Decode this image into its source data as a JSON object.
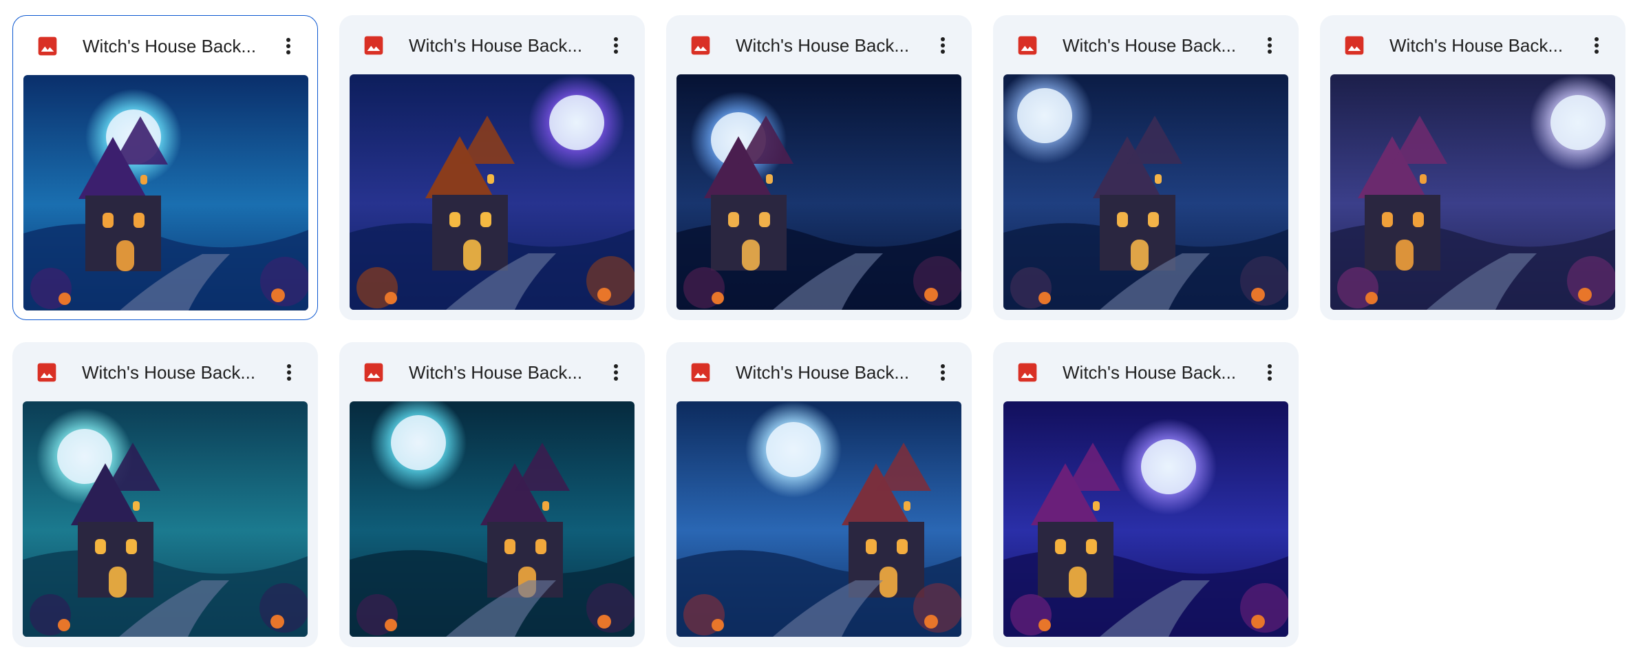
{
  "files": [
    {
      "name": "Witch's House Back...",
      "icon": "image-file-icon",
      "selected": true,
      "palette": [
        "#0a2f6b",
        "#1a6fb0",
        "#5bc8e8",
        "#3c1f6e",
        "#f2a23a"
      ]
    },
    {
      "name": "Witch's House Back...",
      "icon": "image-file-icon",
      "selected": false,
      "palette": [
        "#0d1e5c",
        "#27338f",
        "#6a4bd1",
        "#8a3c1c",
        "#f5b942"
      ]
    },
    {
      "name": "Witch's House Back...",
      "icon": "image-file-icon",
      "selected": false,
      "palette": [
        "#061233",
        "#18356e",
        "#5a8fd8",
        "#4a1e4f",
        "#f0b04a"
      ]
    },
    {
      "name": "Witch's House Back...",
      "icon": "image-file-icon",
      "selected": false,
      "palette": [
        "#0b1c45",
        "#1f3f80",
        "#6d8fc9",
        "#3a2b55",
        "#f3b348"
      ]
    },
    {
      "name": "Witch's House Back...",
      "icon": "image-file-icon",
      "selected": false,
      "palette": [
        "#1c1f4a",
        "#3b3f8a",
        "#a8a5d8",
        "#6b2a6e",
        "#f0a03a"
      ]
    },
    {
      "name": "Witch's House Back...",
      "icon": "image-file-icon",
      "selected": false,
      "palette": [
        "#0b3d55",
        "#1b7a8f",
        "#6fd0d8",
        "#2a1e55",
        "#f5b540"
      ]
    },
    {
      "name": "Witch's House Back...",
      "icon": "image-file-icon",
      "selected": false,
      "palette": [
        "#062a3e",
        "#0f5d78",
        "#4fc1d6",
        "#3a1d4f",
        "#f2a83c"
      ]
    },
    {
      "name": "Witch's House Back...",
      "icon": "image-file-icon",
      "selected": false,
      "palette": [
        "#0d2b5e",
        "#2a67b4",
        "#8fc5ea",
        "#7a2f3d",
        "#f4ad3f"
      ]
    },
    {
      "name": "Witch's House Back...",
      "icon": "image-file-icon",
      "selected": false,
      "palette": [
        "#120f5c",
        "#2a2fa8",
        "#7d6ee0",
        "#6a1f7a",
        "#f6b23e"
      ]
    }
  ]
}
